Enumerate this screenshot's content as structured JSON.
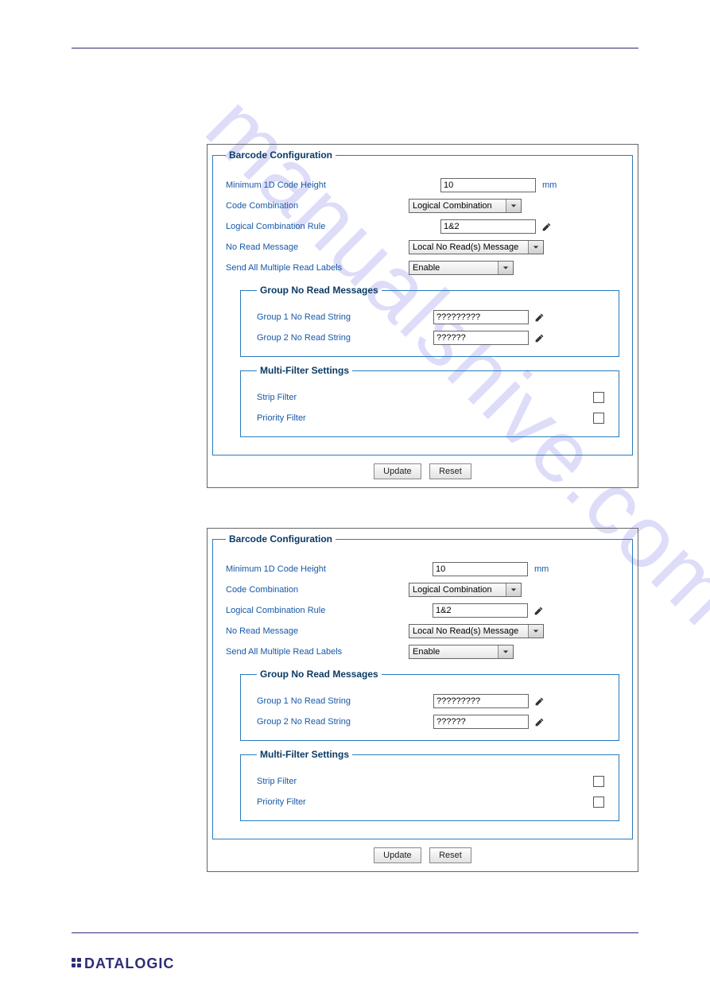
{
  "watermark": "manualshive.com",
  "footer_logo": "DATALOGIC",
  "panel": {
    "title": "Barcode Configuration",
    "rows": {
      "min_height": {
        "label": "Minimum 1D Code Height",
        "value": "10",
        "unit": "mm"
      },
      "code_combo": {
        "label": "Code Combination",
        "value": "Logical Combination"
      },
      "logic_rule": {
        "label": "Logical Combination Rule",
        "value": "1&2"
      },
      "no_read_msg": {
        "label": "No Read Message",
        "value": "Local No Read(s) Message"
      },
      "send_all": {
        "label": "Send All Multiple Read Labels",
        "value": "Enable"
      }
    },
    "group_title": "Group No Read Messages",
    "group_rows": {
      "g1": {
        "label": "Group 1 No Read String",
        "value": "?????????"
      },
      "g2": {
        "label": "Group 2 No Read String",
        "value": "??????"
      }
    },
    "multi_title": "Multi-Filter Settings",
    "multi_rows": {
      "strip": {
        "label": "Strip Filter"
      },
      "priority": {
        "label": "Priority Filter"
      }
    },
    "buttons": {
      "update": "Update",
      "reset": "Reset"
    }
  }
}
